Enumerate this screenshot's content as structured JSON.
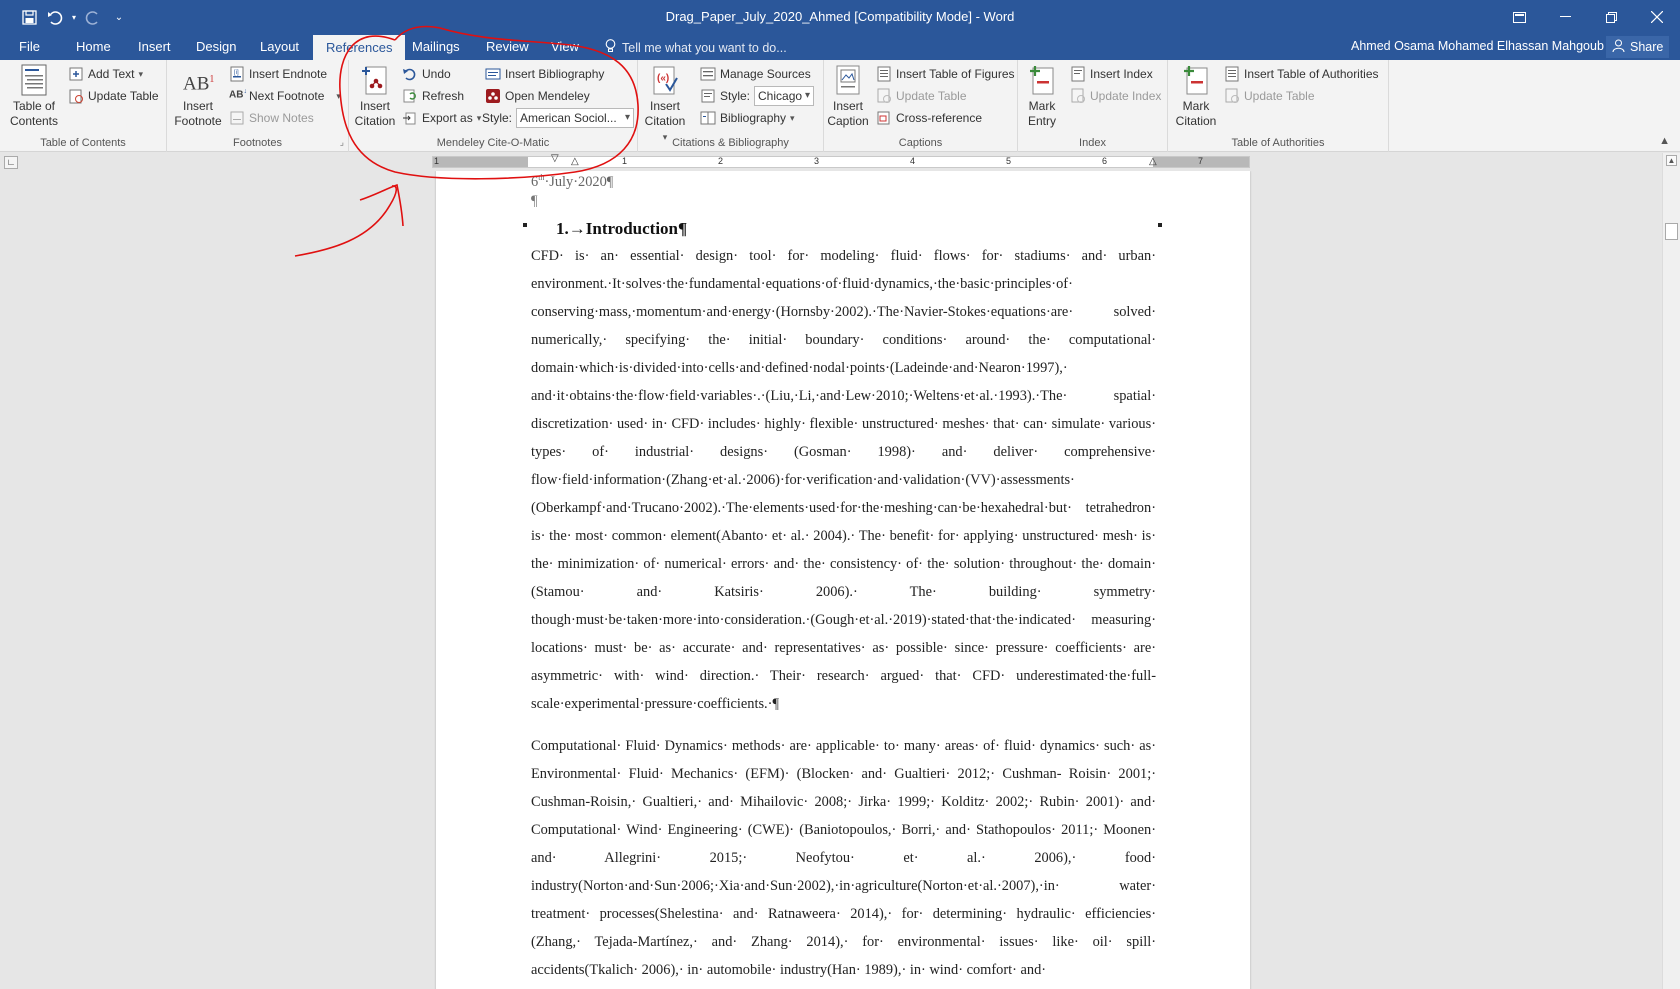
{
  "window": {
    "title": "Drag_Paper_July_2020_Ahmed [Compatibility Mode] - Word"
  },
  "tabs": [
    {
      "label": "File"
    },
    {
      "label": "Home"
    },
    {
      "label": "Insert"
    },
    {
      "label": "Design"
    },
    {
      "label": "Layout"
    },
    {
      "label": "References"
    },
    {
      "label": "Mailings"
    },
    {
      "label": "Review"
    },
    {
      "label": "View"
    }
  ],
  "tell_me": "Tell me what you want to do...",
  "user_name": "Ahmed Osama Mohamed Elhassan Mahgoub",
  "share_label": "Share",
  "ribbon": {
    "toc": {
      "table_of_contents": "Table of Contents",
      "add_text": "Add Text",
      "update_table": "Update Table",
      "group": "Table of Contents"
    },
    "footnotes": {
      "insert_footnote": "Insert Footnote",
      "insert_endnote": "Insert Endnote",
      "next_footnote": "Next Footnote",
      "show_notes": "Show Notes",
      "group": "Footnotes"
    },
    "mendeley": {
      "insert_citation": "Insert Citation",
      "undo": "Undo",
      "refresh": "Refresh",
      "export_as": "Export as",
      "insert_bibliography": "Insert Bibliography",
      "open_mendeley": "Open Mendeley",
      "style_label": "Style:",
      "style_value": "American Sociol...",
      "group": "Mendeley Cite-O-Matic"
    },
    "citations": {
      "insert_citation": "Insert Citation",
      "manage_sources": "Manage Sources",
      "style_label": "Style:",
      "style_value": "Chicago",
      "bibliography": "Bibliography",
      "group": "Citations & Bibliography"
    },
    "captions": {
      "insert_caption": "Insert Caption",
      "insert_table_of_figures": "Insert Table of Figures",
      "update_table": "Update Table",
      "cross_reference": "Cross-reference",
      "group": "Captions"
    },
    "index": {
      "mark_entry": "Mark Entry",
      "insert_index": "Insert Index",
      "update_index": "Update Index",
      "group": "Index"
    },
    "authorities": {
      "mark_citation": "Mark Citation",
      "insert_table_of_authorities": "Insert Table of Authorities",
      "update_table": "Update Table",
      "group": "Table of Authorities"
    }
  },
  "ruler": {
    "numbers": [
      "1",
      "1",
      "2",
      "3",
      "4",
      "5",
      "6",
      "7"
    ]
  },
  "document": {
    "date_day": "6",
    "date_sup": "th",
    "date_rest": "·July·2020¶",
    "empty_para": "¶",
    "heading": "1.→Introduction¶",
    "paragraph1": "CFD· is· an· essential· design· tool· for· modeling· fluid· flows· for· stadiums· and· urban· environment.·It·solves·the·fundamental·equations·of·fluid·dynamics,·the·basic·principles·of· conserving·mass,·momentum·and·energy·(Hornsby·2002).·The·Navier-Stokes·equations·are· solved· numerically,· specifying· the· initial· boundary· conditions· around· the· computational· domain·which·is·divided·into·cells·and·defined·nodal·points·(Ladeinde·and·Nearon·1997),· and·it·obtains·the·flow·field·variables·.·(Liu,·Li,·and·Lew·2010;·Weltens·et·al.·1993).·The· spatial· discretization· used· in· CFD· includes· highly· flexible· unstructured· meshes· that· can· simulate· various· types· of· industrial· designs· (Gosman· 1998)· and· deliver· comprehensive· flow·field·information·(Zhang·et·al.·2006)·for·verification·and·validation·(VV)·assessments· (Oberkampf·and·Trucano·2002).·The·elements·used·for·the·meshing·can·be·hexahedral·but· tetrahedron· is· the· most· common· element(Abanto· et· al.· 2004).· The· benefit· for· applying· unstructured· mesh· is· the· minimization· of· numerical· errors· and· the· consistency· of· the· solution· throughout· the· domain· (Stamou· and· Katsiris· 2006).· The· building· symmetry· though·must·be·taken·more·into·consideration.·(Gough·et·al.·2019)·stated·that·the·indicated· measuring· locations· must· be· as· accurate· and· representatives· as· possible· since· pressure· coefficients· are· asymmetric· with· wind· direction.· Their· research· argued· that· CFD· underestimated·the·full-scale·experimental·pressure·coefficients.·¶",
    "paragraph2": "Computational· Fluid· Dynamics· methods· are· applicable· to· many· areas· of· fluid· dynamics· such· as· Environmental· Fluid· Mechanics· (EFM)· (Blocken· and· Gualtieri· 2012;· Cushman- Roisin· 2001;· Cushman-Roisin,· Gualtieri,· and· Mihailovic· 2008;· Jirka· 1999;· Kolditz· 2002;· Rubin· 2001)· and· Computational· Wind· Engineering· (CWE)· (Baniotopoulos,· Borri,· and· Stathopoulos· 2011;· Moonen· and· Allegrini· 2015;· Neofytou· et· al.· 2006),· food· industry(Norton·and·Sun·2006;·Xia·and·Sun·2002),·in·agriculture(Norton·et·al.·2007),·in· water· treatment· processes(Shelestina· and· Ratnaweera· 2014),· for· determining· hydraulic· efficiencies· (Zhang,· Tejada-Martínez,· and· Zhang· 2014),· for· environmental· issues· like· oil· spill· accidents(Tkalich· 2006),· in· automobile· industry(Han· 1989),· in· wind· comfort· and·"
  },
  "colors": {
    "word_blue": "#2b579a",
    "ribbon_bg": "#f3f3f3",
    "annotation_red": "#e01010"
  }
}
